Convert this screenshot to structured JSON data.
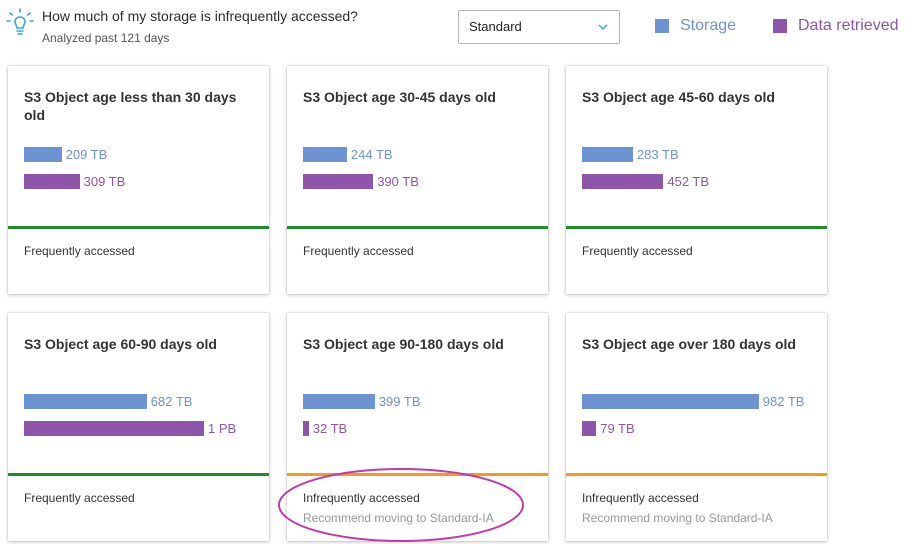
{
  "header": {
    "question": "How much of my storage is infrequently accessed?",
    "subtitle": "Analyzed past 121 days",
    "icon": "lightbulb-icon"
  },
  "storage_class_select": {
    "selected": "Standard",
    "icon": "chevron-down-icon"
  },
  "legend": {
    "storage": {
      "label": "Storage",
      "color": "#6e93d3"
    },
    "retrieved": {
      "label": "Data retrieved",
      "color": "#8d56aa"
    }
  },
  "colors": {
    "frequent": "#1f8a2e",
    "infrequent": "#f29b1d",
    "highlight": "#c23aa8"
  },
  "cards": [
    {
      "title": "S3 Object age less than 30 days old",
      "storage_tb": 209,
      "storage_label": "209 TB",
      "retrieved_tb": 309,
      "retrieved_label": "309 TB",
      "status": "Frequently accessed",
      "recommendation": "",
      "frequent": true
    },
    {
      "title": "S3 Object age 30-45 days old",
      "storage_tb": 244,
      "storage_label": "244 TB",
      "retrieved_tb": 390,
      "retrieved_label": "390 TB",
      "status": "Frequently accessed",
      "recommendation": "",
      "frequent": true
    },
    {
      "title": "S3 Object age 45-60 days old",
      "storage_tb": 283,
      "storage_label": "283 TB",
      "retrieved_tb": 452,
      "retrieved_label": "452 TB",
      "status": "Frequently accessed",
      "recommendation": "",
      "frequent": true
    },
    {
      "title": "S3 Object age 60-90 days old",
      "storage_tb": 682,
      "storage_label": "682 TB",
      "retrieved_tb": 1000,
      "retrieved_label": "1 PB",
      "status": "Frequently accessed",
      "recommendation": "",
      "frequent": true
    },
    {
      "title": "S3 Object age 90-180 days old",
      "storage_tb": 399,
      "storage_label": "399 TB",
      "retrieved_tb": 32,
      "retrieved_label": "32 TB",
      "status": "Infrequently accessed",
      "recommendation": "Recommend moving to Standard-IA",
      "frequent": false
    },
    {
      "title": "S3 Object age over 180 days old",
      "storage_tb": 982,
      "storage_label": "982 TB",
      "retrieved_tb": 79,
      "retrieved_label": "79 TB",
      "status": "Infrequently accessed",
      "recommendation": "Recommend moving to Standard-IA",
      "frequent": false
    }
  ]
}
